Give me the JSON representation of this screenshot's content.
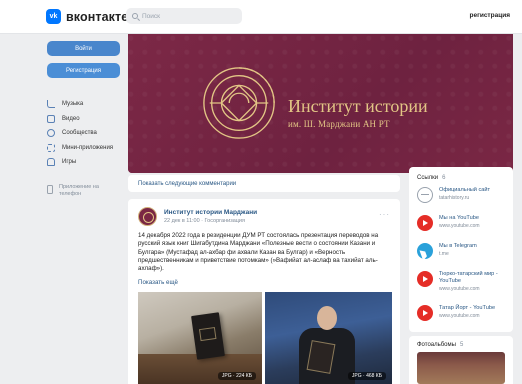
{
  "header": {
    "logo_mark": "vk",
    "logo_text": "вконтакте",
    "search_placeholder": "Поиск",
    "register_link": "регистрация"
  },
  "sidebar": {
    "login_button": "Войти",
    "register_button": "Регистрация",
    "items": [
      {
        "label": "Музыка",
        "icon": "music-icon"
      },
      {
        "label": "Видео",
        "icon": "video-icon"
      },
      {
        "label": "Сообщества",
        "icon": "groups-icon"
      },
      {
        "label": "Мини-приложения",
        "icon": "apps-icon"
      },
      {
        "label": "Игры",
        "icon": "games-icon"
      }
    ],
    "mobile_apps": "Приложение на телефон"
  },
  "cover": {
    "title": "Институт истории",
    "subtitle": "им. Ш. Марджани АН РТ"
  },
  "main": {
    "show_comments": "Показать следующие комментарии",
    "post": {
      "author": "Институт истории Марджани",
      "meta": "22 дек в 11:00 · Госорганизация",
      "menu": "···",
      "text": "14 декабря 2022 года в резиденции ДУМ РТ состоялась презентация переводов на русский язык книг Шигабутдина Марджани «Полезные вести о состоянии Казани и Булгара» (Мустафад ал-ахбар фи ахвали Казан ва Булгар) и «Верность предшественникам и приветствие потомкам» (»Вафийат ал-аслаф ва тахийат аль-ахлаф»).",
      "show_more": "Показать ещё",
      "photos": [
        {
          "badge": "JPG · 224 КБ"
        },
        {
          "badge": "JPG · 468 КБ"
        }
      ]
    }
  },
  "right": {
    "links_title": "Ссылки",
    "links_count": "6",
    "links": [
      {
        "title": "Официальный сайт",
        "url": "tatarhistory.ru",
        "icon": "site-icon"
      },
      {
        "title": "Мы на YouTube",
        "url": "www.youtube.com",
        "icon": "youtube-icon"
      },
      {
        "title": "Мы в Telegram",
        "url": "t.me",
        "icon": "telegram-icon"
      },
      {
        "title": "Тюрко-татарский мир - YouTube",
        "url": "www.youtube.com",
        "icon": "youtube-icon"
      },
      {
        "title": "Татар Йорт - YouTube",
        "url": "www.youtube.com",
        "icon": "youtube-icon"
      }
    ],
    "albums_title": "Фотоальбомы",
    "albums_count": "5"
  },
  "colors": {
    "accent": "#4986cc",
    "link": "#2a5885",
    "cover_bg": "#7a2744",
    "cover_gold": "#e2c585"
  }
}
